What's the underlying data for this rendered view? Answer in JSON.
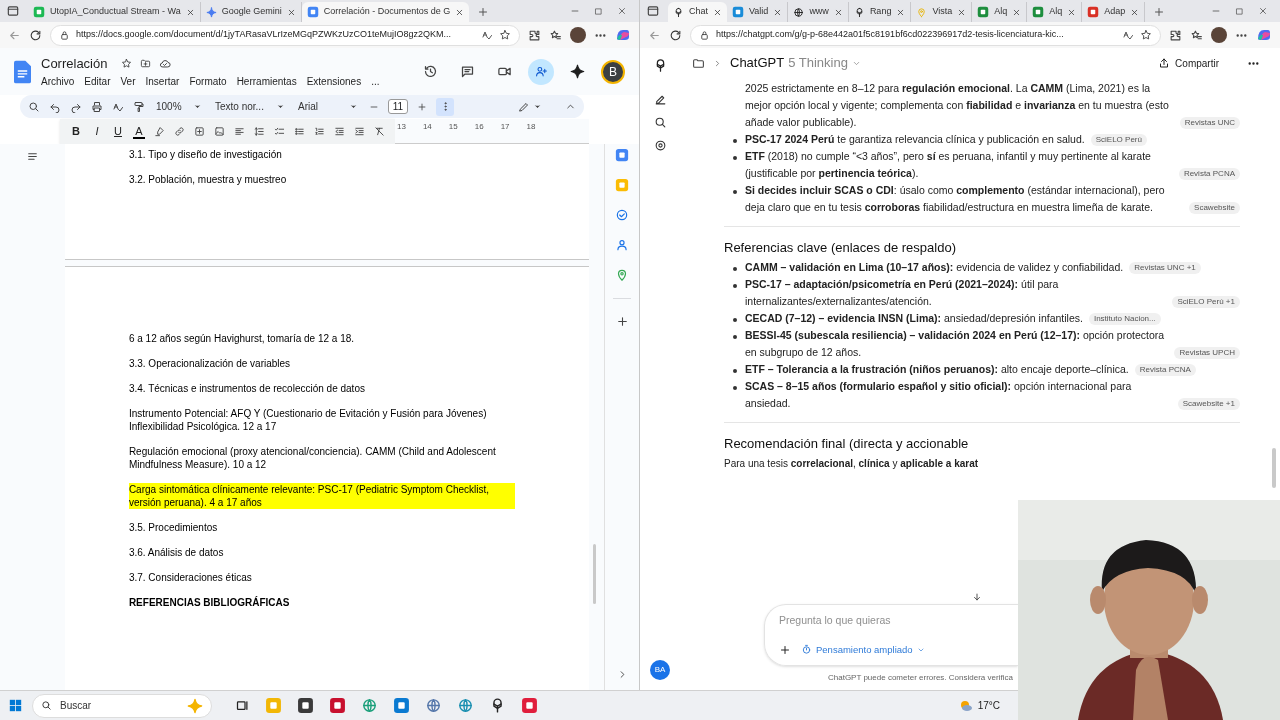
{
  "left_browser": {
    "tabs": [
      {
        "title": "UtopIA_Conductual Stream - Wa",
        "selected": false
      },
      {
        "title": "Google Gemini",
        "selected": false
      },
      {
        "title": "Correlación - Documentos de G",
        "selected": true
      }
    ],
    "url": "https://docs.google.com/document/d/1jyTARasaVLrIzeMGqPZWKzUzCO1teMujIO8gz2QKM..."
  },
  "doc": {
    "title": "Correlación",
    "menu": [
      "Archivo",
      "Editar",
      "Ver",
      "Insertar",
      "Formato",
      "Herramientas",
      "Extensiones",
      "..."
    ],
    "avatar": "B",
    "zoom": "100%",
    "style": "Texto nor...",
    "font": "Arial",
    "font_size": "11",
    "format_letters": [
      "B",
      "I",
      "U",
      "A"
    ],
    "ruler": [
      "13",
      "14",
      "15",
      "16",
      "17",
      "18"
    ],
    "page1": [
      {
        "text": "3.1. Tipo y diseño de investigación",
        "bold": false,
        "highlighted": false
      },
      {
        "text": "3.2. Población, muestra y muestreo",
        "bold": false,
        "highlighted": false
      }
    ],
    "page2": [
      {
        "text": "6 a 12 años según Havighurst, tomaría de 12 a 18.",
        "bold": false,
        "highlighted": false
      },
      {
        "text": "3.3. Operacionalización de variables",
        "bold": false,
        "highlighted": false
      },
      {
        "text": "3.4. Técnicas e instrumentos de recolección de datos",
        "bold": false,
        "highlighted": false
      },
      {
        "text": "Instrumento Potencial: AFQ Y (Cuestionario de Evitación y Fusión para Jóvenes) Inflexibilidad Psicológica. 12 a 17",
        "bold": false,
        "highlighted": false
      },
      {
        "text": "Regulación emocional (proxy atencional/conciencia). CAMM (Child and Adolescent Mindfulness Measure). 10 a 12",
        "bold": false,
        "highlighted": false
      },
      {
        "text": "Carga sintomática clínicamente relevante: PSC-17 (Pediatric Symptom Checklist, versión peruana). 4 a 17 años",
        "bold": false,
        "highlighted": true
      },
      {
        "text": "3.5. Procedimientos",
        "bold": false,
        "highlighted": false
      },
      {
        "text": "3.6. Análisis de datos",
        "bold": false,
        "highlighted": false
      },
      {
        "text": "3.7. Consideraciones éticas",
        "bold": false,
        "highlighted": false
      },
      {
        "text": "REFERENCIAS BIBLIOGRÁFICAS",
        "bold": true,
        "highlighted": false
      }
    ]
  },
  "right_browser": {
    "tabs": [
      {
        "title": "Chat",
        "selected": true
      },
      {
        "title": "Valid",
        "selected": false
      },
      {
        "title": "www",
        "selected": false
      },
      {
        "title": "Rang",
        "selected": false
      },
      {
        "title": "Vista",
        "selected": false
      },
      {
        "title": "Alq",
        "selected": false
      },
      {
        "title": "Alq",
        "selected": false
      },
      {
        "title": "Adap",
        "selected": false
      }
    ],
    "url": "https://chatgpt.com/g/g-p-68e442a01f5c8191bf6cd022396917d2-tesis-licenciatura-kic..."
  },
  "chat": {
    "title": "ChatGPT",
    "model": "5 Thinking",
    "share": "Compartir",
    "avatar": "BA",
    "sections": [
      {
        "kind": "list",
        "items": [
          {
            "bullet": false,
            "text": "2025 estrictamente en 8–12 para **regulación emocional**. La **CAMM** (Lima, 2021) es la mejor opción local y vigente; complementa con **fiabilidad** e **invarianza** en tu muestra (esto añade valor publicable).",
            "source": "Revistas UNC"
          },
          {
            "bullet": true,
            "text": "**PSC-17 2024 Perú** te garantiza relevancia clínica y publicación en salud.",
            "source": "SciELO Perú"
          },
          {
            "bullet": true,
            "text": "**ETF** (2018) no cumple “<3 años”, pero **sí** es peruana, infantil y muy pertinente al karate (justificable por **pertinencia teórica**).",
            "source": "Revista PCNA"
          },
          {
            "bullet": true,
            "text": "**Si decides incluir SCAS o CDI**: úsalo como **complemento** (estándar internacional), pero deja claro que en tu tesis **corroboras** fiabilidad/estructura en muestra limeña de karate.",
            "source": "Scawebsite"
          }
        ]
      },
      {
        "kind": "heading",
        "text": "Referencias clave (enlaces de respaldo)"
      },
      {
        "kind": "list",
        "items": [
          {
            "bullet": true,
            "text": "**CAMM – validación en Lima (10–17 años):** evidencia de validez y confiabilidad.",
            "source": "Revistas UNC +1"
          },
          {
            "bullet": true,
            "text": "**PSC-17 – adaptación/psicometría en Perú (2021–2024):** útil para internalizantes/externalizantes/atención.",
            "source": "SciELO Perú +1"
          },
          {
            "bullet": true,
            "text": "**CECAD (7–12) – evidencia INSN (Lima):** ansiedad/depresión infantiles.",
            "source": "Instituto Nacion..."
          },
          {
            "bullet": true,
            "text": "**BESSI-45 (subescala resiliencia) – validación 2024 en Perú (12–17):** opción protectora en subgrupo de 12 años.",
            "source": "Revistas UPCH"
          },
          {
            "bullet": true,
            "text": "**ETF – Tolerancia a la frustración (niños peruanos):** alto encaje deporte–clínica.",
            "source": "Revista PCNA"
          },
          {
            "bullet": true,
            "text": "**SCAS – 8–15 años (formulario español y sitio oficial):** opción internacional para ansiedad.",
            "source": "Scawebsite +1"
          }
        ]
      },
      {
        "kind": "heading",
        "text": "Recomendación final (directa y accionable"
      },
      {
        "kind": "paragraph",
        "text": "Para una tesis **correlacional**, **clínica** y **aplicable a karat**"
      }
    ],
    "composer": {
      "placeholder": "Pregunta lo que quieras",
      "mode": "Pensamiento ampliado"
    },
    "disclaimer": "ChatGPT puede cometer errores. Considera verifica"
  },
  "taskbar": {
    "search": "Buscar",
    "temperature": "17°C"
  }
}
